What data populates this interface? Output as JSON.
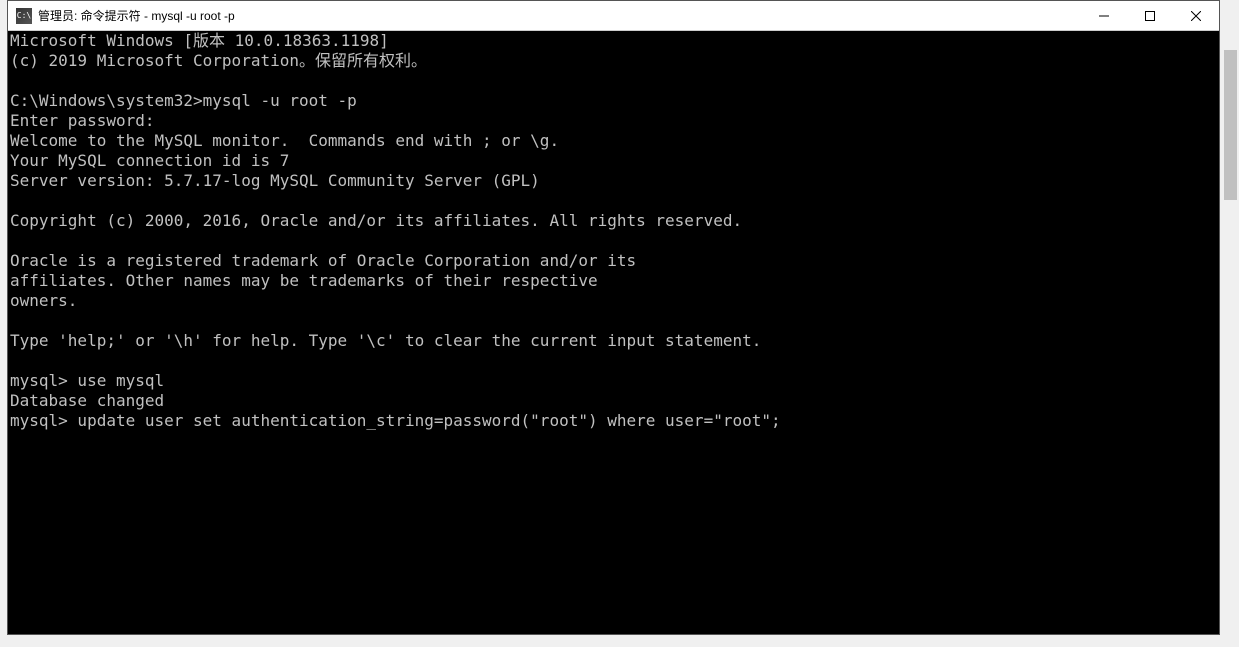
{
  "titlebar": {
    "icon_text": "C:\\",
    "title": "管理员: 命令提示符 - mysql  -u root -p"
  },
  "terminal": {
    "lines": [
      "Microsoft Windows [版本 10.0.18363.1198]",
      "(c) 2019 Microsoft Corporation。保留所有权利。",
      "",
      "C:\\Windows\\system32>mysql -u root -p",
      "Enter password:",
      "Welcome to the MySQL monitor.  Commands end with ; or \\g.",
      "Your MySQL connection id is 7",
      "Server version: 5.7.17-log MySQL Community Server (GPL)",
      "",
      "Copyright (c) 2000, 2016, Oracle and/or its affiliates. All rights reserved.",
      "",
      "Oracle is a registered trademark of Oracle Corporation and/or its",
      "affiliates. Other names may be trademarks of their respective",
      "owners.",
      "",
      "Type 'help;' or '\\h' for help. Type '\\c' to clear the current input statement.",
      "",
      "mysql> use mysql",
      "Database changed",
      "mysql> update user set authentication_string=password(\"root\") where user=\"root\";"
    ]
  }
}
